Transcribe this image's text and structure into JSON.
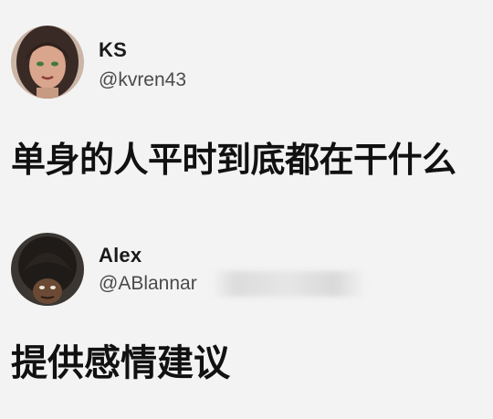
{
  "tweets": [
    {
      "author_name": "KS",
      "author_handle": "@kvren43",
      "text": "单身的人平时到底都在干什么"
    },
    {
      "author_name": "Alex",
      "author_handle": "@ABlannar",
      "text": "提供感情建议"
    }
  ],
  "colors": {
    "background": "#f3f3f3",
    "text": "#111111",
    "handle": "#4a4a4a"
  }
}
